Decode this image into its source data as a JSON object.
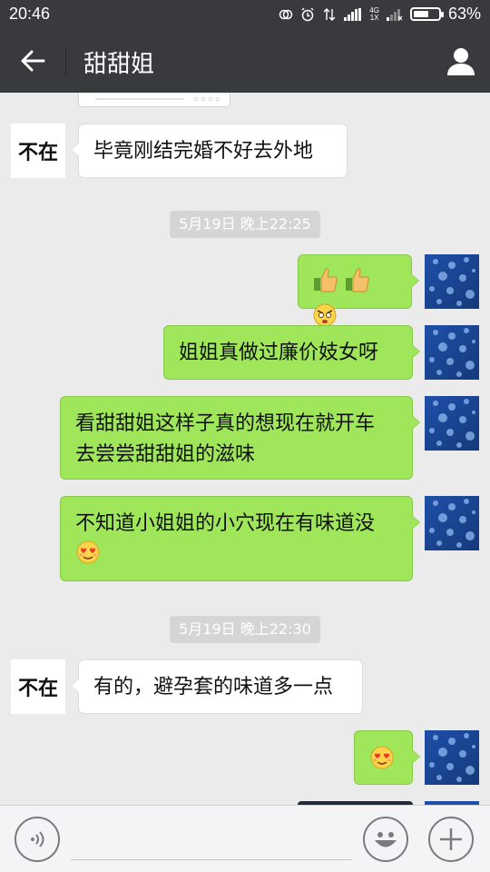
{
  "status_bar": {
    "time": "20:46",
    "network_top": "4G",
    "network_bottom": "1X",
    "battery_percent": "63%",
    "battery_level": 0.63,
    "icons": [
      "sync-icon",
      "alarm-icon",
      "data-arrows-icon",
      "signal-icon",
      "signal-weak-icon",
      "battery-icon"
    ]
  },
  "header": {
    "title": "甜甜姐",
    "back_icon": "back-arrow-icon",
    "profile_icon": "person-icon"
  },
  "messages": [
    {
      "from": "other",
      "avatar_text": "不在",
      "text": "毕竟刚结完婚不好去外地"
    },
    {
      "type": "timestamp",
      "text": "5月19日 晚上22:25"
    },
    {
      "from": "me",
      "text": "",
      "emojis": [
        "thumbs-up-emoji",
        "thumbs-up-emoji",
        "angry-face-emoji"
      ]
    },
    {
      "from": "me",
      "text": "姐姐真做过廉价妓女呀"
    },
    {
      "from": "me",
      "line1": "看甜甜姐这样子真的想现在就开车",
      "line2": "去尝尝甜甜姐的滋味"
    },
    {
      "from": "me",
      "text": "不知道小姐姐的小穴现在有味道没",
      "emojis": [
        "heart-eyes-emoji"
      ]
    },
    {
      "type": "timestamp",
      "text": "5月19日 晚上22:30"
    },
    {
      "from": "other",
      "avatar_text": "不在",
      "text": "有的，避孕套的味道多一点"
    },
    {
      "from": "me",
      "text": "",
      "emojis": [
        "heart-eyes-emoji"
      ]
    }
  ],
  "input_bar": {
    "voice_icon": "voice-icon",
    "emoji_icon": "smiley-icon",
    "more_icon": "plus-icon"
  },
  "colors": {
    "header_bg": "#393a3e",
    "chat_bg": "#ebebeb",
    "out_bubble": "#9fe65a",
    "in_bubble": "#ffffff"
  }
}
